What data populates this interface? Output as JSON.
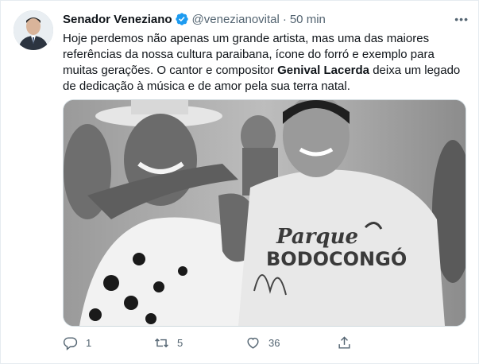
{
  "tweet": {
    "author_name": "Senador Veneziano",
    "handle": "@venezianovital",
    "separator": "·",
    "time": "50 min",
    "more": "•••",
    "text_before": "Hoje perdemos não apenas um grande artista, mas uma das maiores referências da nossa cultura paraibana, ícone do forró e exemplo para muitas gerações. O cantor e compositor ",
    "text_bold": "Genival Lacerda",
    "text_after": " deixa um legado de dedicação à música e de amor pela sua terra natal.",
    "photo": {
      "shirt_text_line1": "Parque",
      "shirt_text_line2": "BODOCONGÓ"
    },
    "actions": {
      "replies": "1",
      "retweets": "5",
      "likes": "36"
    },
    "colors": {
      "verified": "#1d9bf0",
      "muted": "#536471",
      "text": "#0f1419"
    }
  }
}
